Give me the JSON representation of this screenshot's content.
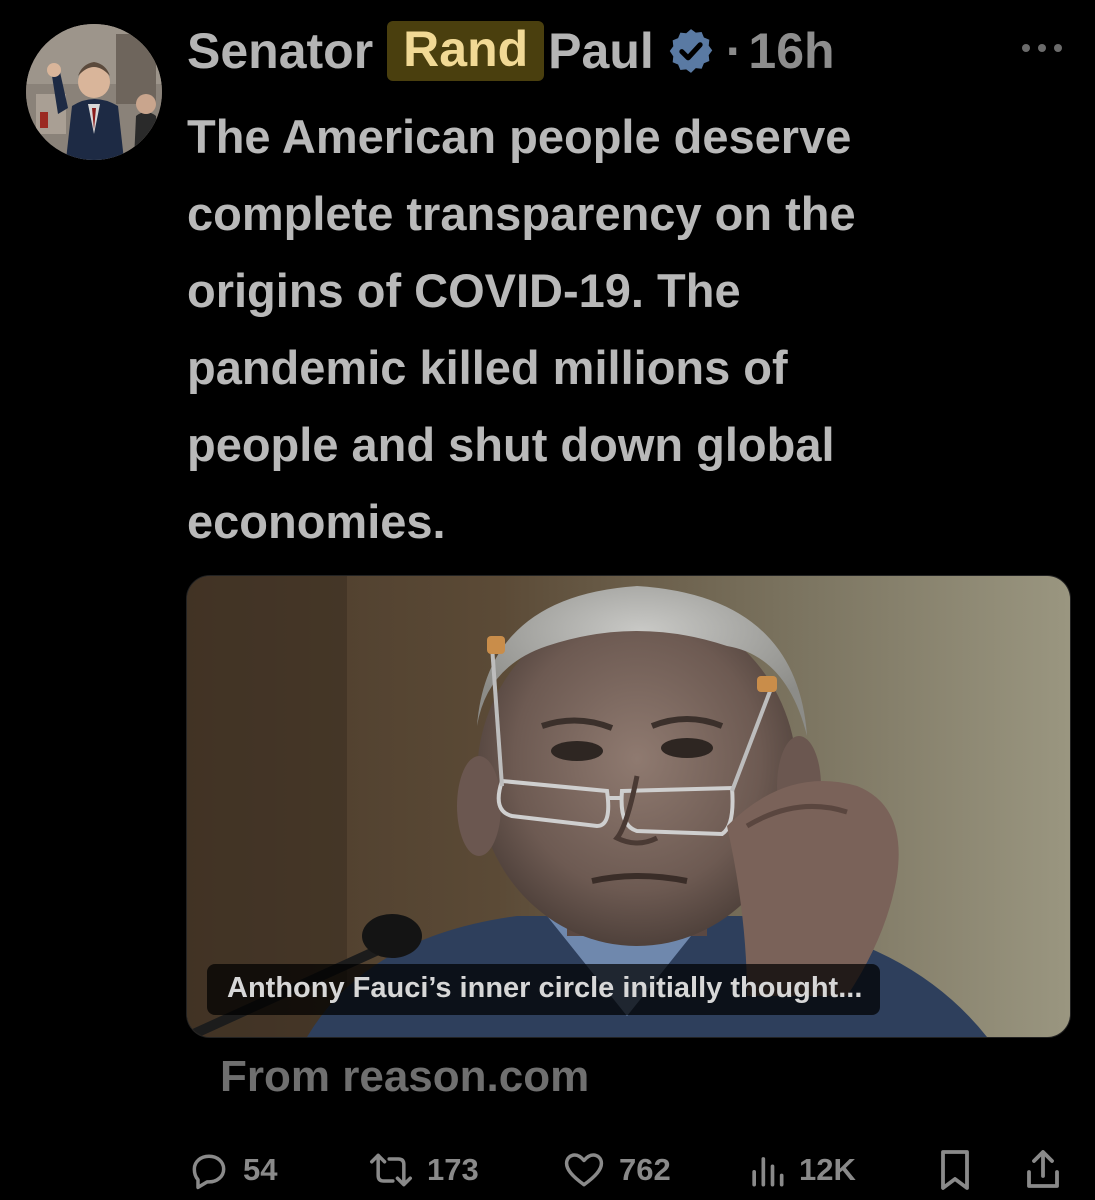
{
  "author": {
    "name_prefix": "Senator",
    "name_highlight": "Rand",
    "name_suffix": "Paul",
    "verified": true,
    "time": "16h",
    "separator": "·"
  },
  "tweet": {
    "lines": [
      "The American people deserve",
      "complete transparency on the",
      "origins of COVID-19. The",
      "pandemic killed millions of",
      "people and shut down global",
      "economies."
    ]
  },
  "card": {
    "caption": "Anthony Fauci’s inner circle initially thought...",
    "source": "From reason.com"
  },
  "actions": {
    "replies": "54",
    "retweets": "173",
    "likes": "762",
    "views": "12K"
  },
  "icons": {
    "more": "more-icon",
    "verified": "verified-badge-icon",
    "reply": "reply-icon",
    "retweet": "retweet-icon",
    "like": "heart-icon",
    "views": "views-icon",
    "bookmark": "bookmark-icon",
    "share": "share-icon"
  },
  "colors": {
    "background": "#000000",
    "highlight_bg": "#4a3f0e",
    "highlight_text": "#f1d995",
    "text": "#b9b9b9",
    "muted": "#8a8a8a"
  }
}
